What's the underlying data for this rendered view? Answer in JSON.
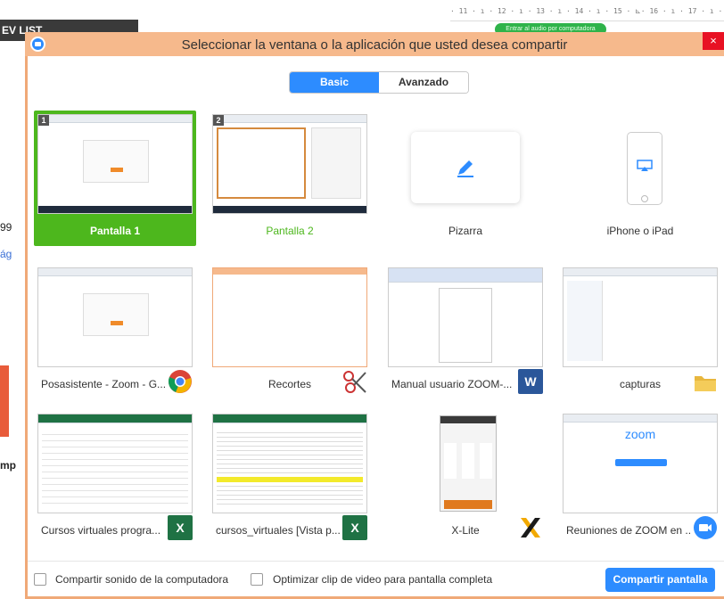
{
  "background": {
    "ruler_text": "· 11 · ı · 12 · ı · 13 · ı · 14 · ı · 15 ·  ⊾· 16 · ı · 17 · ı · 18 ·",
    "top_left_label": "EV LIST",
    "green_pill": "Entrar al audio por computadora",
    "side_texts": [
      "99",
      "ág",
      "mp"
    ]
  },
  "dialog": {
    "title": "Seleccionar la ventana o la aplicación que usted desea compartir",
    "close": "×",
    "tabs": {
      "basic": "Basic",
      "advanced": "Avanzado"
    }
  },
  "tiles": [
    {
      "label": "Pantalla 1",
      "number": "1"
    },
    {
      "label": "Pantalla 2",
      "number": "2"
    },
    {
      "label": "Pizarra"
    },
    {
      "label": "iPhone o iPad"
    },
    {
      "label": "Posasistente - Zoom - G..."
    },
    {
      "label": "Recortes"
    },
    {
      "label": "Manual usuario ZOOM-..."
    },
    {
      "label": "capturas"
    },
    {
      "label": "Cursos virtuales progra..."
    },
    {
      "label": "cursos_virtuales  [Vista p..."
    },
    {
      "label": "X-Lite"
    },
    {
      "label": "Reuniones de ZOOM en ..."
    }
  ],
  "app_icons": {
    "chrome": "chrome-icon",
    "scissors": "scissors-icon",
    "word": "W",
    "folder": "folder-icon",
    "excel": "X",
    "xlite": "xlite-icon",
    "zoom": "zoom-camera-icon"
  },
  "zoom_thumb": {
    "brand": "zoom"
  },
  "bottom": {
    "share_sound": "Compartir sonido de la computadora",
    "optimize_video": "Optimizar clip de video para pantalla completa",
    "share_button": "Compartir pantalla"
  },
  "colors": {
    "accent": "#2d8cff",
    "selected": "#4db71d",
    "frame": "#f0a978"
  }
}
